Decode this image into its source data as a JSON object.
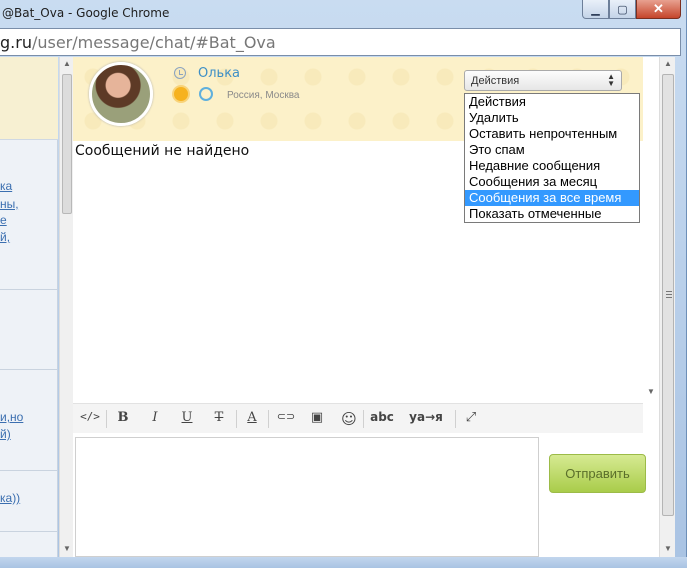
{
  "window": {
    "title": "@Bat_Ova - Google Chrome",
    "min_glyph": "▁",
    "max_glyph": "▢",
    "close_glyph": "✕"
  },
  "address": {
    "host": "g.ru",
    "path": "/user/message/chat/#Bat_Ova"
  },
  "sidebar": {
    "links": [
      "ка",
      "ны,",
      "е",
      "й,",
      "и,но",
      "й)",
      "ка))"
    ]
  },
  "profile": {
    "name": "Олька",
    "location": "Россия, Москва"
  },
  "actions": {
    "selected": "Действия",
    "options": [
      "Действия",
      "Удалить",
      "Оставить непрочтенным",
      "Это спам",
      "Недавние сообщения",
      "Сообщения за месяц",
      "Сообщения за все время",
      "Показать отмеченные"
    ],
    "highlighted_index": 6
  },
  "chat": {
    "empty_text": "Сообщений не найдено"
  },
  "toolbar": {
    "source": "</>",
    "bold": "B",
    "italic": "I",
    "underline": "U",
    "strike": "T",
    "color": "A",
    "link": "⊂⊃",
    "image": "▣",
    "emoji": "☺",
    "spell": "abc",
    "translit": "ya→я",
    "expand": "⤢"
  },
  "composer": {
    "send_label": "Отправить"
  },
  "colors": {
    "accent_link": "#3d8fc6",
    "selection": "#3399ff",
    "send_button": "#a9cc4a"
  }
}
